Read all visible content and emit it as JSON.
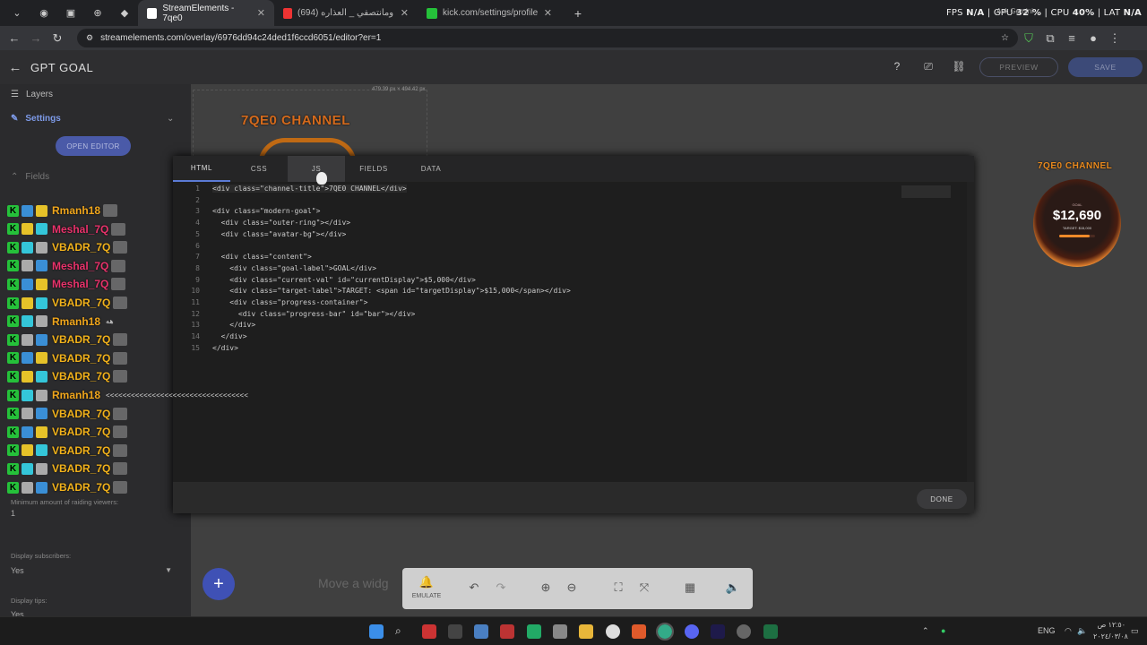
{
  "browser": {
    "tabs": [
      {
        "label": "StreamElements - 7qe0"
      },
      {
        "label": "خايبه ومانتصفي _ العذاره (694)"
      },
      {
        "label": "kick.com/settings/profile"
      }
    ],
    "url": "streamelements.com/overlay/6976dd94c24ded1f6ccd6051/editor?er=1",
    "hud": {
      "fps_label": "FPS",
      "fps_value": "N/A",
      "gpu_label": "GPU",
      "gpu_value": "32 %",
      "cpu_label": "CPU",
      "cpu_value": "40%",
      "lat_label": "LAT",
      "lat_value": "N/A",
      "overlay_title": "Ask Gemini"
    }
  },
  "app": {
    "title": "GPT GOAL",
    "preview_label": "PREVIEW",
    "save_label": "SAVE"
  },
  "sidebar": {
    "layers_label": "Layers",
    "settings_label": "Settings",
    "open_editor_label": "OPEN EDITOR",
    "fields_label": "Fields",
    "min_raid_label": "Minimum amount of raiding viewers:",
    "min_raid_value": "1",
    "display_subs_label": "Display subscribers:",
    "display_subs_value": "Yes",
    "display_tips_label": "Display tips:",
    "display_tips_value": "Yes",
    "obscured_hint": "Yes"
  },
  "canvas": {
    "dimensions": "479.39 px × 494.42 px",
    "channel_title": "7QE0 CHANNEL",
    "move_hint": "Move a widg"
  },
  "goal_widget": {
    "channel_title": "7QE0 CHANNEL",
    "goal_label": "GOAL",
    "current": "$12,690",
    "target_text": "TARGET: $15,000",
    "progress": 0.846
  },
  "editor": {
    "tabs": [
      "HTML",
      "CSS",
      "JS",
      "FIELDS",
      "DATA"
    ],
    "active_tab": "HTML",
    "done_label": "DONE",
    "lines": [
      "<div class=\"channel-title\">7QE0 CHANNEL</div>",
      "",
      "<div class=\"modern-goal\">",
      "  <div class=\"outer-ring\"></div>",
      "  <div class=\"avatar-bg\"></div>",
      "",
      "  <div class=\"content\">",
      "    <div class=\"goal-label\">GOAL</div>",
      "    <div class=\"current-val\" id=\"currentDisplay\">$5,000</div>",
      "    <div class=\"target-label\">TARGET: <span id=\"targetDisplay\">$15,000</span></div>",
      "    <div class=\"progress-container\">",
      "      <div class=\"progress-bar\" id=\"bar\"></div>",
      "    </div>",
      "  </div>",
      "</div>"
    ]
  },
  "chat": [
    {
      "user": "Rmanh18",
      "color": "#f0a61c",
      "tail": ""
    },
    {
      "user": "Meshal_7Q",
      "color": "#e8326b",
      "tail": ""
    },
    {
      "user": "VBADR_7Q",
      "color": "#f2b21b",
      "tail": ""
    },
    {
      "user": "Meshal_7Q",
      "color": "#e8326b",
      "tail": ""
    },
    {
      "user": "Meshal_7Q",
      "color": "#e8326b",
      "tail": ""
    },
    {
      "user": "VBADR_7Q",
      "color": "#f2b21b",
      "tail": ""
    },
    {
      "user": "Rmanh18",
      "color": "#f0a61c",
      "tail": "هه"
    },
    {
      "user": "VBADR_7Q",
      "color": "#f2b21b",
      "tail": ""
    },
    {
      "user": "VBADR_7Q",
      "color": "#f2b21b",
      "tail": ""
    },
    {
      "user": "VBADR_7Q",
      "color": "#f2b21b",
      "tail": ""
    },
    {
      "user": "Rmanh18",
      "color": "#f0a61c",
      "tail": "<<<<<<<<<<<<<<<<<<<<<<<<<<<<<<<<<<"
    },
    {
      "user": "VBADR_7Q",
      "color": "#f2b21b",
      "tail": ""
    },
    {
      "user": "VBADR_7Q",
      "color": "#f2b21b",
      "tail": ""
    },
    {
      "user": "VBADR_7Q",
      "color": "#f2b21b",
      "tail": ""
    },
    {
      "user": "VBADR_7Q",
      "color": "#f2b21b",
      "tail": ""
    },
    {
      "user": "VBADR_7Q",
      "color": "#f2b21b",
      "tail": ""
    }
  ],
  "toolbar": {
    "emulate_label": "EMULATE"
  },
  "taskbar": {
    "lang": "ENG",
    "time": "١٢:٥٠ ص",
    "date": "٢٠٢٤/٠٣/٠٨"
  },
  "colors": {
    "accent": "#3f51b5",
    "kick_green": "#25c13a",
    "editor_bg": "#1e1e1e"
  }
}
